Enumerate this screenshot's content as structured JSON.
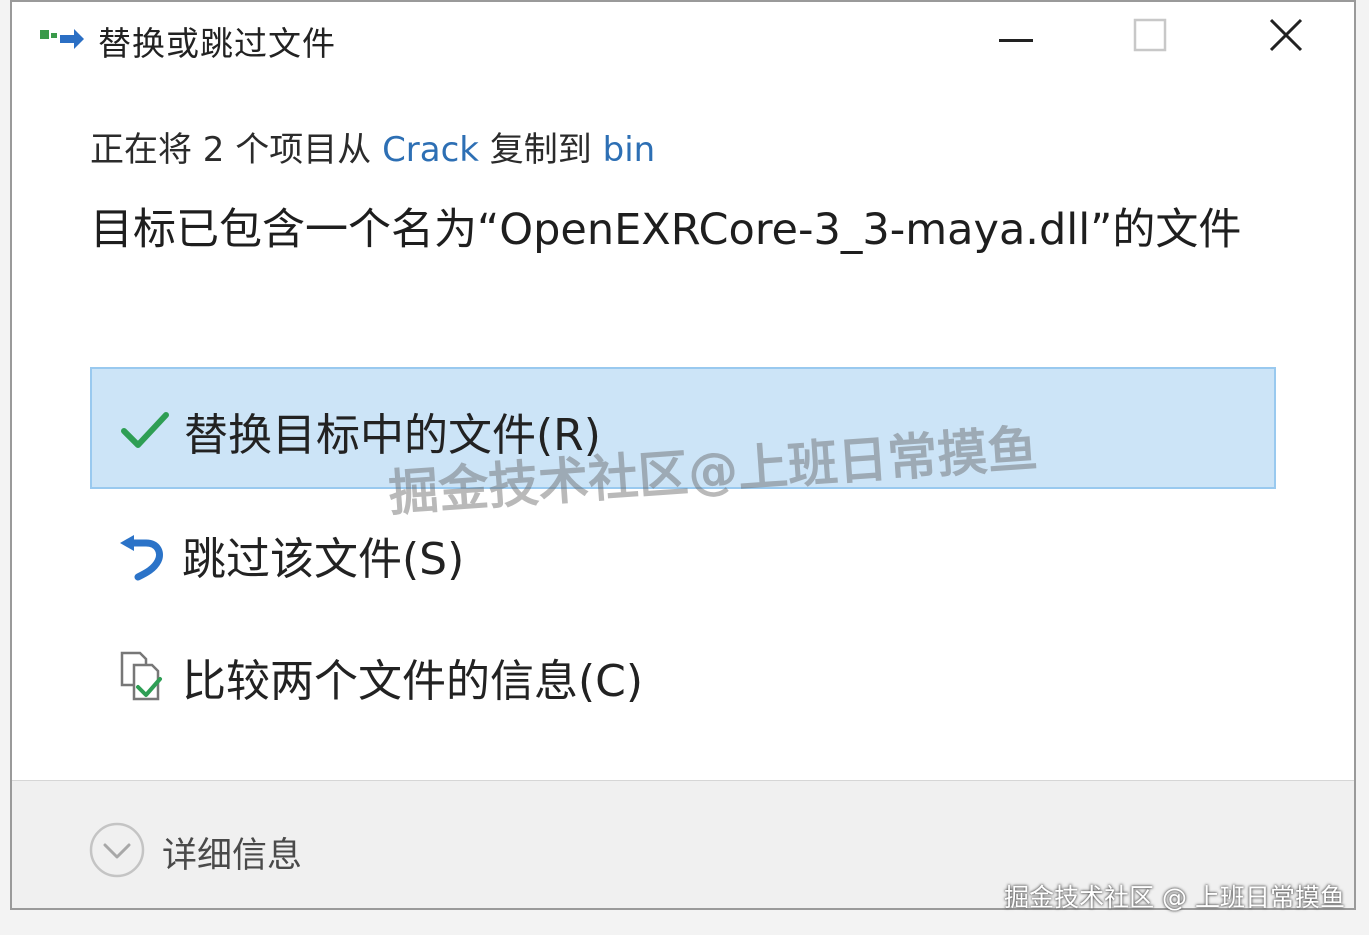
{
  "window": {
    "title": "替换或跳过文件"
  },
  "titlebar_buttons": {
    "minimize_icon": "minimize-icon",
    "maximize_icon": "maximize-icon",
    "close_icon": "close-icon"
  },
  "copy_status": {
    "prefix": "正在将 2 个项目从 ",
    "source": "Crack",
    "middle": " 复制到 ",
    "destination": "bin"
  },
  "message": "目标已包含一个名为“OpenEXRCore-3_3-maya.dll”的文件",
  "options": [
    {
      "label": "替换目标中的文件(R)",
      "icon": "checkmark-icon",
      "selected": true
    },
    {
      "label": "跳过该文件(S)",
      "icon": "skip-arrow-icon",
      "selected": false
    },
    {
      "label": "比较两个文件的信息(C)",
      "icon": "compare-files-icon",
      "selected": false
    }
  ],
  "footer": {
    "details_label": "详细信息",
    "details_icon": "chevron-down-icon"
  },
  "watermarks": {
    "center": "掘金技术社区@上班日常摸鱼",
    "corner": "掘金技术社区 @ 上班日常摸鱼"
  },
  "colors": {
    "link": "#2d6fb4",
    "selected_bg": "#cce4f7",
    "selected_border": "#99c9ef",
    "check": "#2e9e54",
    "skip": "#2b73c8"
  }
}
